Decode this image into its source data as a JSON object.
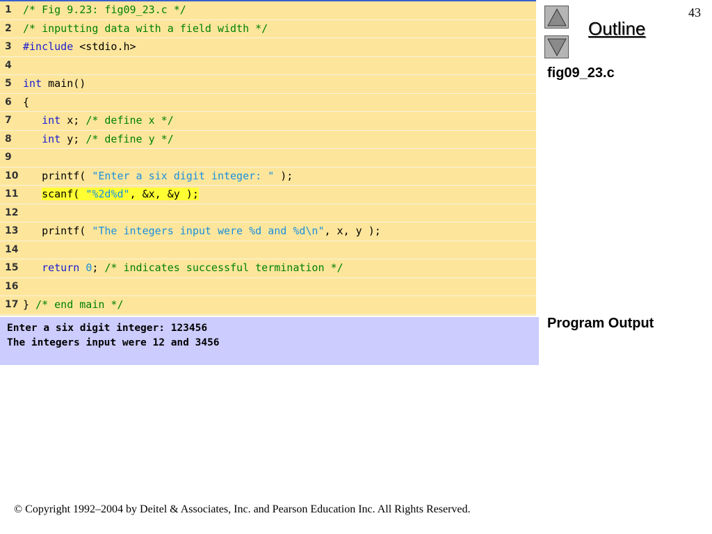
{
  "slide": {
    "page_number": "43"
  },
  "sidebar": {
    "outline_label": "Outline",
    "file_label": "fig09_23.c",
    "output_label": "Program Output"
  },
  "code_lines": [
    {
      "n": "1",
      "segments": [
        {
          "t": "/* Fig 9.23: fig09_23.c */",
          "c": "cm"
        }
      ]
    },
    {
      "n": "2",
      "segments": [
        {
          "t": "/* inputting data with a field width */",
          "c": "cm"
        }
      ]
    },
    {
      "n": "3",
      "segments": [
        {
          "t": "#include",
          "c": "kw"
        },
        {
          "t": " <stdio.h>",
          "c": ""
        }
      ]
    },
    {
      "n": "4",
      "segments": []
    },
    {
      "n": "5",
      "segments": [
        {
          "t": "int",
          "c": "kw"
        },
        {
          "t": " main()",
          "c": ""
        }
      ]
    },
    {
      "n": "6",
      "segments": [
        {
          "t": "{",
          "c": ""
        }
      ]
    },
    {
      "n": "7",
      "segments": [
        {
          "t": "   ",
          "c": ""
        },
        {
          "t": "int",
          "c": "kw"
        },
        {
          "t": " x; ",
          "c": ""
        },
        {
          "t": "/* define x */",
          "c": "cm"
        }
      ]
    },
    {
      "n": "8",
      "segments": [
        {
          "t": "   ",
          "c": ""
        },
        {
          "t": "int",
          "c": "kw"
        },
        {
          "t": " y; ",
          "c": ""
        },
        {
          "t": "/* define y */",
          "c": "cm"
        }
      ]
    },
    {
      "n": "9",
      "segments": []
    },
    {
      "n": "10",
      "segments": [
        {
          "t": "   printf( ",
          "c": ""
        },
        {
          "t": "\"Enter a six digit integer: \"",
          "c": "st"
        },
        {
          "t": " );",
          "c": ""
        }
      ]
    },
    {
      "n": "11",
      "segments": [
        {
          "t": "   ",
          "c": ""
        },
        {
          "t": "scanf( ",
          "c": "hl"
        },
        {
          "t": "\"%2d%d\"",
          "c": "st hl"
        },
        {
          "t": ", &x, &y );",
          "c": "hl"
        }
      ]
    },
    {
      "n": "12",
      "segments": []
    },
    {
      "n": "13",
      "segments": [
        {
          "t": "   printf( ",
          "c": ""
        },
        {
          "t": "\"The integers input were %d and %d\\n\"",
          "c": "st"
        },
        {
          "t": ", x, y );",
          "c": ""
        }
      ]
    },
    {
      "n": "14",
      "segments": []
    },
    {
      "n": "15",
      "segments": [
        {
          "t": "   ",
          "c": ""
        },
        {
          "t": "return",
          "c": "kw"
        },
        {
          "t": " ",
          "c": ""
        },
        {
          "t": "0",
          "c": "num"
        },
        {
          "t": "; ",
          "c": ""
        },
        {
          "t": "/* indicates successful termination */",
          "c": "cm"
        }
      ]
    },
    {
      "n": "16",
      "segments": []
    },
    {
      "n": "17",
      "segments": [
        {
          "t": "} ",
          "c": ""
        },
        {
          "t": "/* end main */",
          "c": "cm"
        }
      ]
    }
  ],
  "program_output": [
    "Enter a six digit integer: 123456",
    "The integers input were 12 and 3456"
  ],
  "footer": {
    "copyright": "© Copyright 1992–2004 by Deitel & Associates, Inc. and Pearson Education Inc. All Rights Reserved."
  },
  "colors": {
    "code_background": "#fde69c",
    "output_background": "#ccccff",
    "keyword": "#1b1bd0",
    "comment": "#008000",
    "string": "#1a8fdc",
    "highlight": "#ffff33"
  }
}
